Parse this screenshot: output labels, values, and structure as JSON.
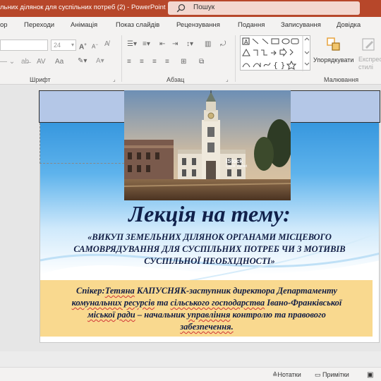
{
  "titlebar": {
    "doc_title": "льних ділянок для суспільних потреб (2)  -  PowerPoint",
    "search_label": "Пошук"
  },
  "tabs": [
    "ор",
    "Переходи",
    "Анімація",
    "Показ слайдів",
    "Рецензування",
    "Подання",
    "Записування",
    "Довідка"
  ],
  "ribbon": {
    "font_size_value": "24",
    "group_font": "Шрифт",
    "group_paragraph": "Абзац",
    "group_drawing": "Малювання",
    "arrange_label": "Упорядкувати",
    "quick_styles_label": "Експрес-стилі",
    "font_grow": "A",
    "font_shrink": "A",
    "spacing_label": "AV",
    "change_case": "Aa"
  },
  "slide": {
    "photo_watermark_brand": "iStock",
    "photo_watermark_credit": "Credit: Pinnet",
    "heading": "Лекція на тему:",
    "subtitle_lines": [
      "«ВИКУП ЗЕМЕЛЬНИХ ДІЛЯНОК ОРГАНАМИ МІСЦЕВОГО",
      "САМОВРЯДУВАННЯ  ДЛЯ СУСПІЛЬНИХ ПОТРЕБ ЧИ З МОТИВІВ",
      "СУСПІЛЬНОЇ НЕОБХІДНОСТІ»"
    ],
    "speaker": {
      "prefix": "Спікер:",
      "name_first": "Тетяна",
      "name_last": "КАПУСНЯК",
      "line1_rest": "-заступник директора Департаменту",
      "line2_a": "комунальних ресурсів",
      "line2_b": " та ",
      "line2_c": "сільського господарства",
      "line2_d": " Івано-Франківської",
      "line3_a": "міської ради",
      "line3_b": " – начальник ",
      "line3_c": "управління",
      "line3_d": " контролю та правового",
      "line4": "забезпечення."
    }
  },
  "statusbar": {
    "notes_label": "Нотатки",
    "comments_label": "Примітки"
  },
  "colors": {
    "titlebar": "#b7472a",
    "title_placeholder_fill": "#b4c7e7",
    "speaker_box_fill": "#f9d98f",
    "heading_text": "#10204a"
  }
}
